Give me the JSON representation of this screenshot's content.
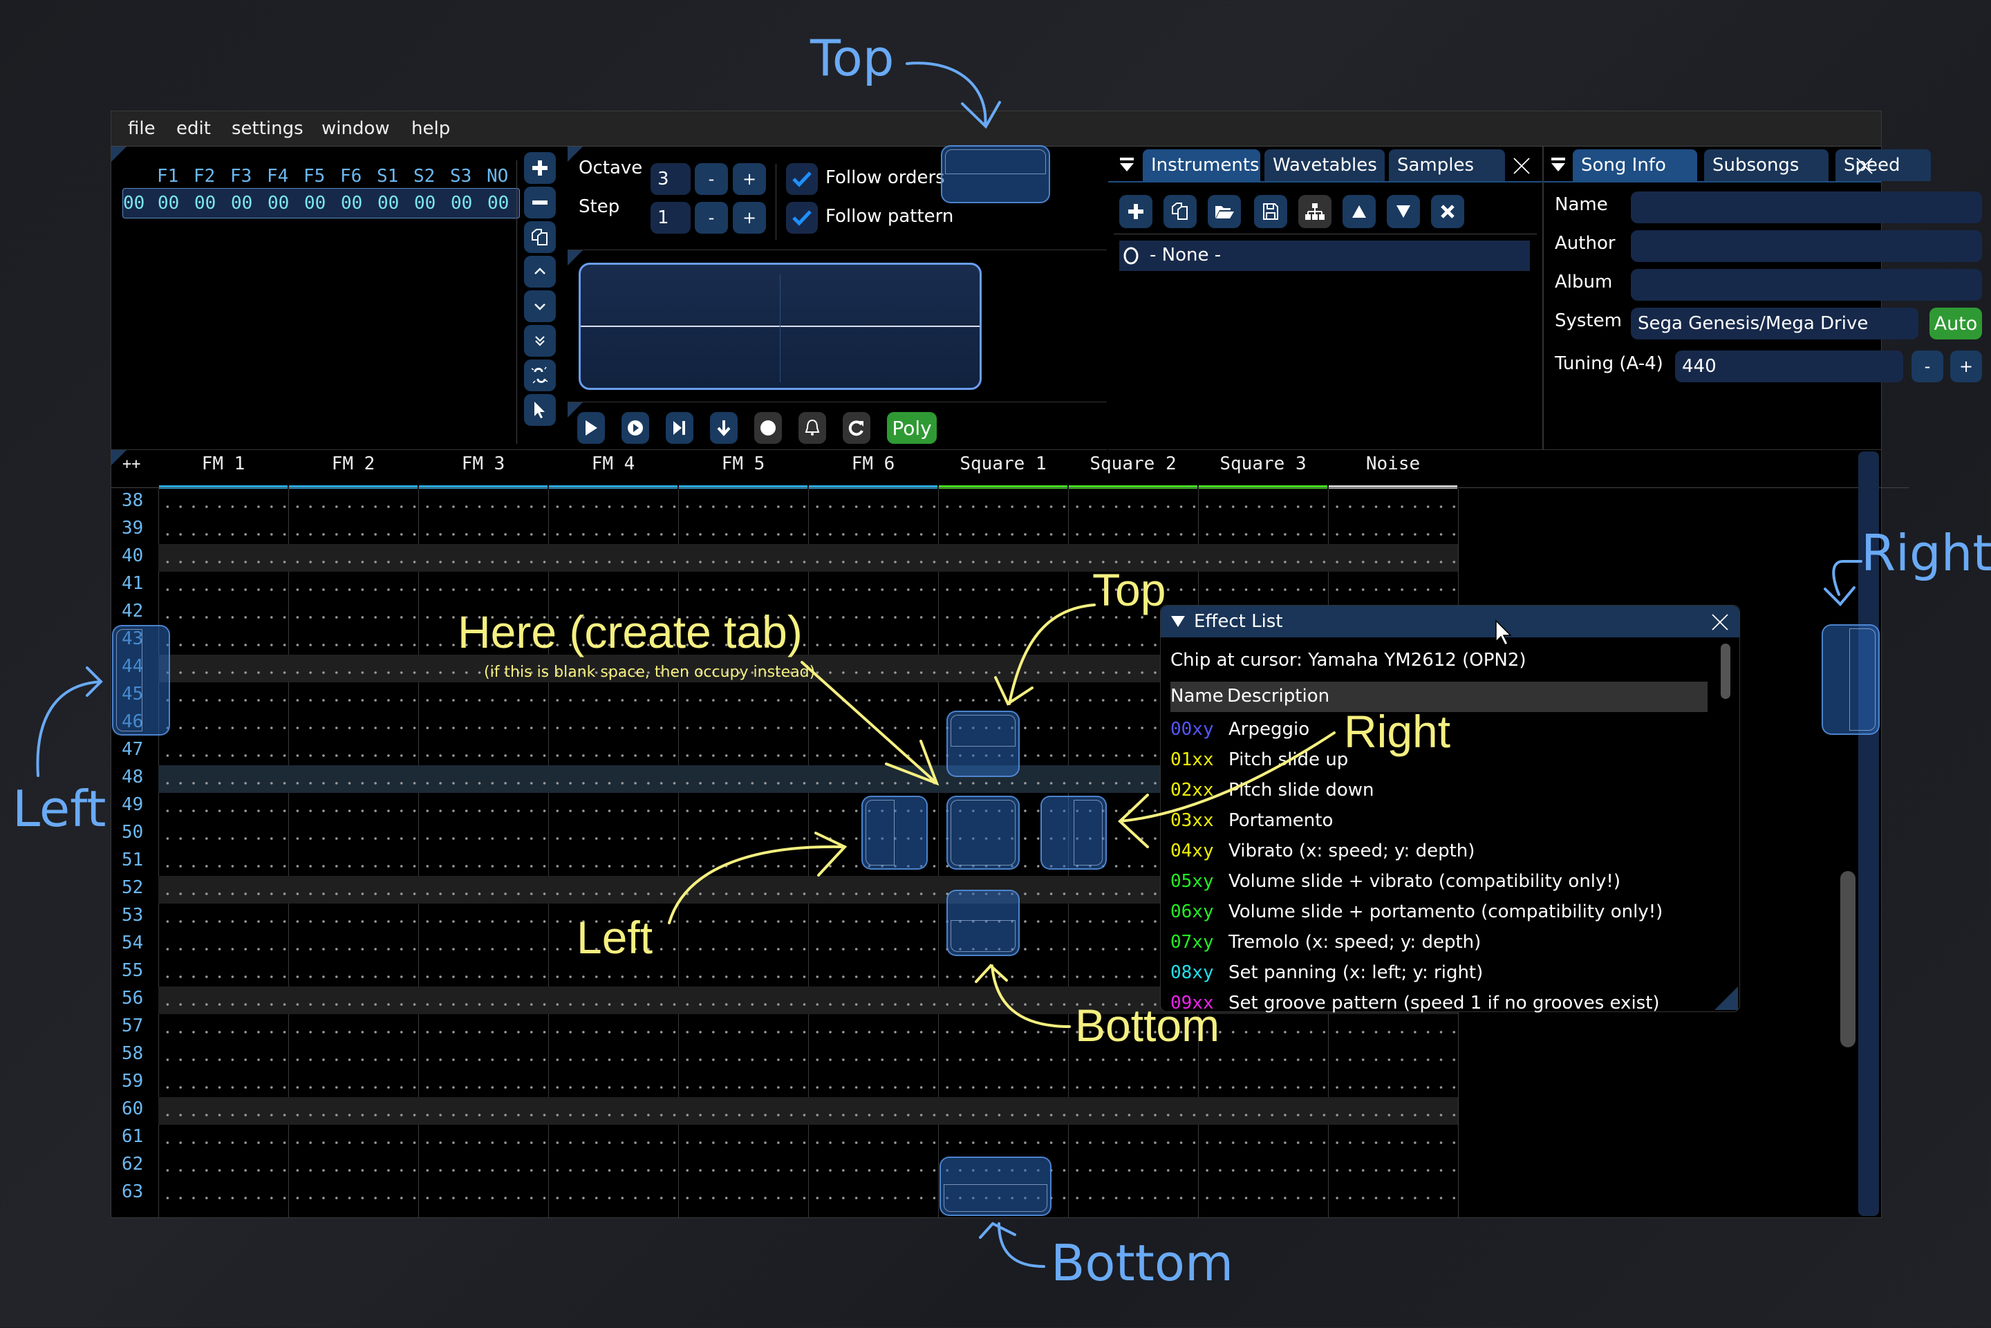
{
  "menu": [
    "file",
    "edit",
    "settings",
    "window",
    "help"
  ],
  "orders": {
    "headers": [
      "F1",
      "F2",
      "F3",
      "F4",
      "F5",
      "F6",
      "S1",
      "S2",
      "S3",
      "NO"
    ],
    "row_index": "00",
    "values": [
      "00",
      "00",
      "00",
      "00",
      "00",
      "00",
      "00",
      "00",
      "00",
      "00"
    ],
    "toolbar_icons": [
      "plus-icon",
      "minus-icon",
      "duplicate-icon",
      "chevron-up-icon",
      "chevron-down-icon",
      "double-chevron-down-icon",
      "unlink-icon",
      "cursor-icon"
    ]
  },
  "edit_controls": {
    "octave_label": "Octave",
    "octave_value": "3",
    "step_label": "Step",
    "step_value": "1",
    "minus": "-",
    "plus": "+",
    "follow_orders": "Follow orders",
    "follow_orders_checked": true,
    "follow_pattern": "Follow pattern",
    "follow_pattern_checked": true
  },
  "playback": {
    "buttons": [
      "play-icon",
      "play-from-cursor-icon",
      "step-icon",
      "step-down-icon",
      "record-icon",
      "metronome-bell-icon",
      "repeat-icon"
    ],
    "poly_label": "Poly"
  },
  "instruments_panel": {
    "tabs": [
      "Instruments",
      "Wavetables",
      "Samples"
    ],
    "active_tab": "Instruments",
    "toolbar_icons": [
      "add-icon",
      "duplicate-icon",
      "open-folder-icon",
      "save-icon",
      "hierarchy-icon",
      "move-up-icon",
      "move-down-icon",
      "delete-icon"
    ],
    "list": [
      {
        "label": "- None -"
      }
    ]
  },
  "song_panel": {
    "tabs": [
      "Song Info",
      "Subsongs",
      "Speed"
    ],
    "active_tab": "Song Info",
    "name_label": "Name",
    "name_value": "",
    "author_label": "Author",
    "author_value": "",
    "album_label": "Album",
    "album_value": "",
    "system_label": "System",
    "system_value": "Sega Genesis/Mega Drive",
    "auto_label": "Auto",
    "tuning_label": "Tuning (A-4)",
    "tuning_value": "440",
    "minus": "-",
    "plus": "+"
  },
  "pattern": {
    "corner_label": "++",
    "channels": [
      {
        "name": "FM 1",
        "color": "#2aa8e0"
      },
      {
        "name": "FM 2",
        "color": "#2aa8e0"
      },
      {
        "name": "FM 3",
        "color": "#2aa8e0"
      },
      {
        "name": "FM 4",
        "color": "#2aa8e0"
      },
      {
        "name": "FM 5",
        "color": "#2aa8e0"
      },
      {
        "name": "FM 6",
        "color": "#2aa8e0"
      },
      {
        "name": "Square 1",
        "color": "#44dd22"
      },
      {
        "name": "Square 2",
        "color": "#44dd22"
      },
      {
        "name": "Square 3",
        "color": "#44dd22"
      },
      {
        "name": "Noise",
        "color": "#cccccc"
      }
    ],
    "rows": [
      "38",
      "39",
      "40",
      "41",
      "42",
      "43",
      "44",
      "45",
      "46",
      "47",
      "48",
      "49",
      "50",
      "51",
      "52",
      "53",
      "54",
      "55",
      "56",
      "57",
      "58",
      "59",
      "60",
      "61",
      "62",
      "63"
    ],
    "highlight_rows": [
      "40",
      "44",
      "52",
      "56",
      "60"
    ],
    "cursor_row": "48"
  },
  "effect_list": {
    "title": "Effect List",
    "chip": "Chip at cursor: Yamaha YM2612 (OPN2)",
    "col_name": "Name",
    "col_desc": "Description",
    "effects": [
      {
        "code": "00xy",
        "desc": "Arpeggio",
        "color": "#5555ff"
      },
      {
        "code": "01xx",
        "desc": "Pitch slide up",
        "color": "#f0f000"
      },
      {
        "code": "02xx",
        "desc": "Pitch slide down",
        "color": "#f0f000"
      },
      {
        "code": "03xx",
        "desc": "Portamento",
        "color": "#f0f000"
      },
      {
        "code": "04xy",
        "desc": "Vibrato (x: speed; y: depth)",
        "color": "#f0f000"
      },
      {
        "code": "05xy",
        "desc": "Volume slide + vibrato (compatibility only!)",
        "color": "#22ee22"
      },
      {
        "code": "06xy",
        "desc": "Volume slide + portamento (compatibility only!)",
        "color": "#22ee22"
      },
      {
        "code": "07xy",
        "desc": "Tremolo (x: speed; y: depth)",
        "color": "#22ee22"
      },
      {
        "code": "08xy",
        "desc": "Set panning (x: left; y: right)",
        "color": "#22e0f0"
      },
      {
        "code": "09xx",
        "desc": "Set groove pattern (speed 1 if no grooves exist)",
        "color": "#ee22ee"
      }
    ]
  },
  "annotations": {
    "outer_top": "Top",
    "outer_left": "Left",
    "outer_right": "Right",
    "outer_bottom": "Bottom",
    "inner_here": "Here (create tab)",
    "inner_here_note": "(if this is blank space, then occupy instead)",
    "inner_top": "Top",
    "inner_left": "Left",
    "inner_right": "Right",
    "inner_bottom": "Bottom"
  },
  "colors": {
    "accent": "#1e4e84",
    "button": "#1a3a60",
    "green": "#2f9a33",
    "annotation_blue": "#6aaaf5",
    "annotation_yellow": "#f5f080"
  }
}
